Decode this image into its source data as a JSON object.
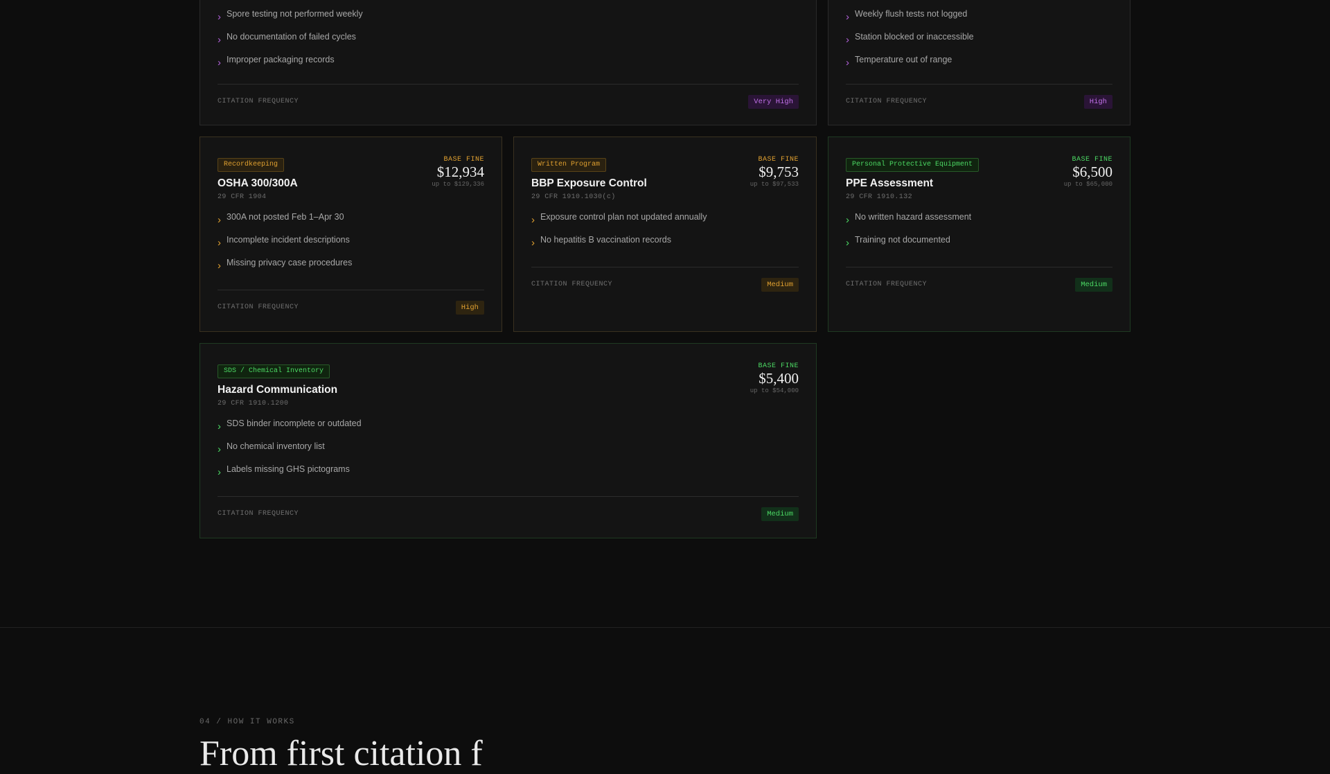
{
  "cards_top": [
    {
      "items": [
        "Spore testing not performed weekly",
        "No documentation of failed cycles",
        "Improper packaging records"
      ],
      "frequency_label": "CITATION FREQUENCY",
      "frequency": "Very High"
    },
    {
      "items": [
        "Weekly flush tests not logged",
        "Station blocked or inaccessible",
        "Temperature out of range"
      ],
      "frequency_label": "CITATION FREQUENCY",
      "frequency": "High"
    }
  ],
  "cards": [
    {
      "tag": "Recordkeeping",
      "title": "OSHA 300/300A",
      "cfr": "29 CFR 1904",
      "fine_label": "BASE FINE",
      "fine": "$12,934",
      "fine_max": "up to $129,336",
      "items": [
        "300A not posted Feb 1–Apr 30",
        "Incomplete incident descriptions",
        "Missing privacy case procedures"
      ],
      "frequency_label": "CITATION FREQUENCY",
      "frequency": "High"
    },
    {
      "tag": "Written Program",
      "title": "BBP Exposure Control",
      "cfr": "29 CFR 1910.1030(c)",
      "fine_label": "BASE FINE",
      "fine": "$9,753",
      "fine_max": "up to $97,533",
      "items": [
        "Exposure control plan not updated annually",
        "No hepatitis B vaccination records"
      ],
      "frequency_label": "CITATION FREQUENCY",
      "frequency": "Medium"
    },
    {
      "tag": "Personal Protective Equipment",
      "title": "PPE Assessment",
      "cfr": "29 CFR 1910.132",
      "fine_label": "BASE FINE",
      "fine": "$6,500",
      "fine_max": "up to $65,000",
      "items": [
        "No written hazard assessment",
        "Training not documented"
      ],
      "frequency_label": "CITATION FREQUENCY",
      "frequency": "Medium"
    },
    {
      "tag": "SDS / Chemical Inventory",
      "title": "Hazard Communication",
      "cfr": "29 CFR 1910.1200",
      "fine_label": "BASE FINE",
      "fine": "$5,400",
      "fine_max": "up to $54,000",
      "items": [
        "SDS binder incomplete or outdated",
        "No chemical inventory list",
        "Labels missing GHS pictograms"
      ],
      "frequency_label": "CITATION FREQUENCY",
      "frequency": "Medium"
    }
  ],
  "section": {
    "eyebrow": "04 / HOW IT WORKS",
    "heading": "From first citation f"
  },
  "colors": {
    "orange": "#e0a030",
    "green": "#4cd964",
    "purple": "#b060d8",
    "background": "#0d0d0d"
  }
}
